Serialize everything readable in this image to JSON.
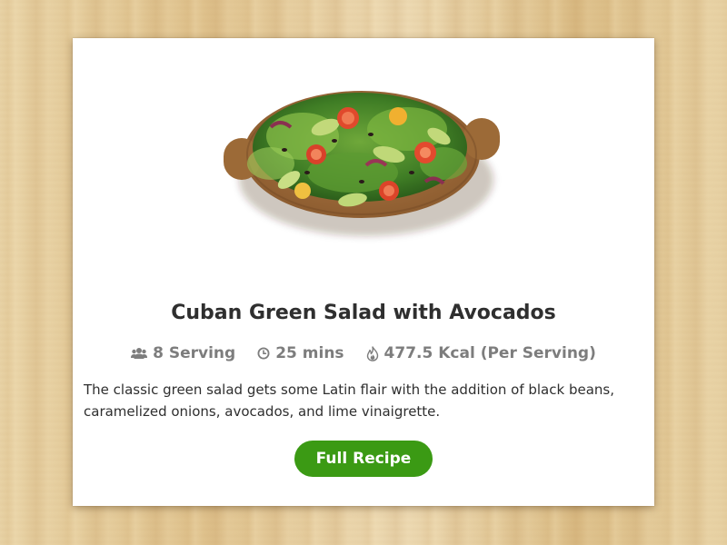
{
  "recipe": {
    "title": "Cuban Green Salad with Avocados",
    "servings": "8 Serving",
    "time": "25 mins",
    "calories": "477.5 Kcal (Per Serving)",
    "description": "The classic green salad gets some Latin flair with the addition of black beans, caramelized onions, avocados, and lime vinaigrette.",
    "button_label": "Full Recipe"
  },
  "icons": {
    "servings": "users-icon",
    "time": "clock-icon",
    "calories": "flame-icon"
  },
  "colors": {
    "button": "#3b9a14",
    "title": "#2f2f2f",
    "meta": "#7d7d7d",
    "background_wood": "#e6cf9f"
  }
}
